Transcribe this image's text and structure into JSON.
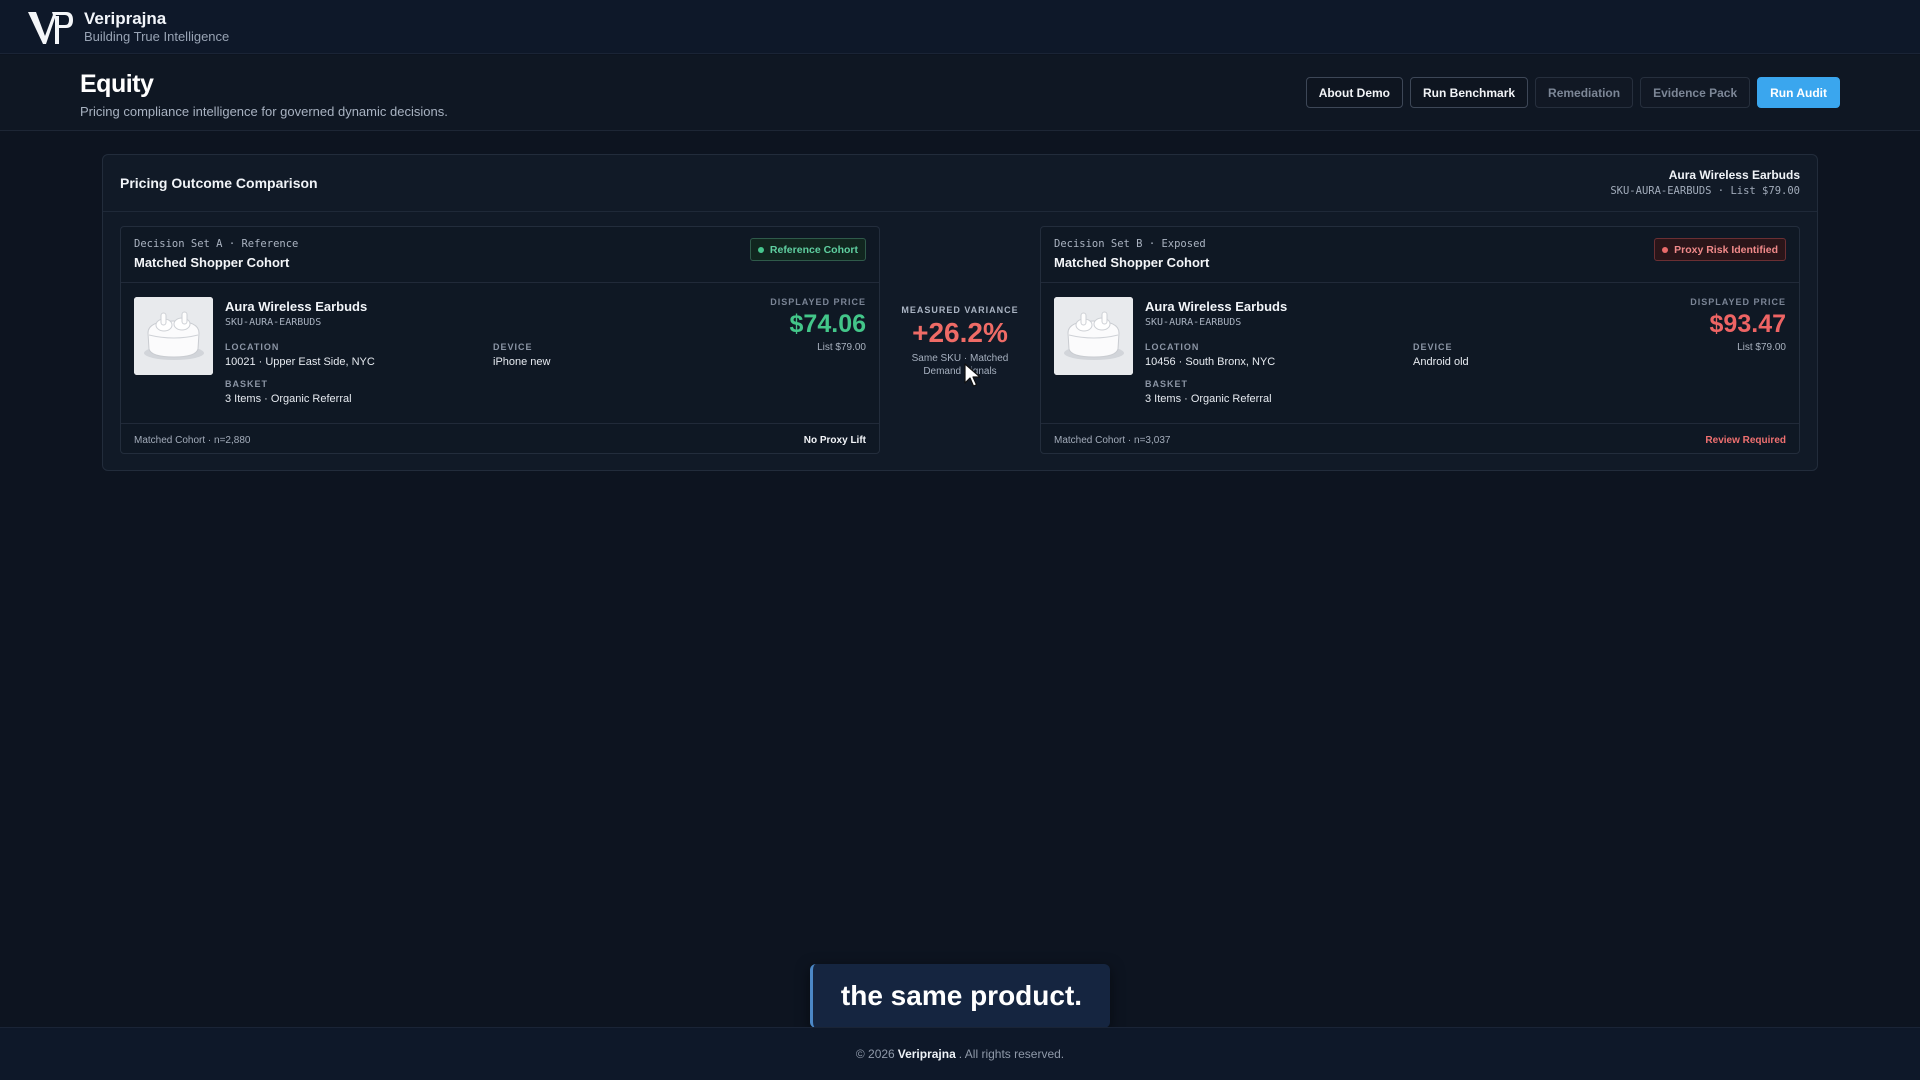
{
  "brand": {
    "name": "Veriprajna",
    "tagline": "Building True Intelligence"
  },
  "page": {
    "title": "Equity",
    "subtitle": "Pricing compliance intelligence for governed dynamic decisions."
  },
  "actions": {
    "about": "About Demo",
    "benchmark": "Run Benchmark",
    "remediation": "Remediation",
    "evidence": "Evidence Pack",
    "audit": "Run Audit"
  },
  "comparison": {
    "title": "Pricing Outcome Comparison",
    "product_name": "Aura Wireless Earbuds",
    "product_meta": "SKU-AURA-EARBUDS · List $79.00"
  },
  "set_a": {
    "label": "Decision Set A · Reference",
    "title": "Matched Shopper Cohort",
    "badge": "Reference Cohort",
    "product": "Aura Wireless Earbuds",
    "sku": "SKU-AURA-EARBUDS",
    "location_label": "LOCATION",
    "location": "10021 · Upper East Side, NYC",
    "device_label": "DEVICE",
    "device": "iPhone new",
    "basket_label": "BASKET",
    "basket": "3 Items · Organic Referral",
    "price_label": "DISPLAYED PRICE",
    "price": "$74.06",
    "list_price": "List $79.00",
    "cohort": "Matched Cohort · n=2,880",
    "verdict": "No Proxy Lift"
  },
  "set_b": {
    "label": "Decision Set B · Exposed",
    "title": "Matched Shopper Cohort",
    "badge": "Proxy Risk Identified",
    "product": "Aura Wireless Earbuds",
    "sku": "SKU-AURA-EARBUDS",
    "location_label": "LOCATION",
    "location": "10456 · South Bronx, NYC",
    "device_label": "DEVICE",
    "device": "Android old",
    "basket_label": "BASKET",
    "basket": "3 Items · Organic Referral",
    "price_label": "DISPLAYED PRICE",
    "price": "$93.47",
    "list_price": "List $79.00",
    "cohort": "Matched Cohort · n=3,037",
    "verdict": "Review Required"
  },
  "variance": {
    "label": "MEASURED VARIANCE",
    "value": "+26.2%",
    "note": "Same SKU · Matched Demand Signals"
  },
  "caption": "the same product.",
  "footer": {
    "prefix": "© 2026",
    "brand": "Veriprajna",
    "suffix": ". All rights reserved."
  },
  "colors": {
    "accent": "#3aa6ee",
    "reference_green": "#43c689",
    "exposed_red": "#ee6464",
    "background": "#0d1420"
  }
}
